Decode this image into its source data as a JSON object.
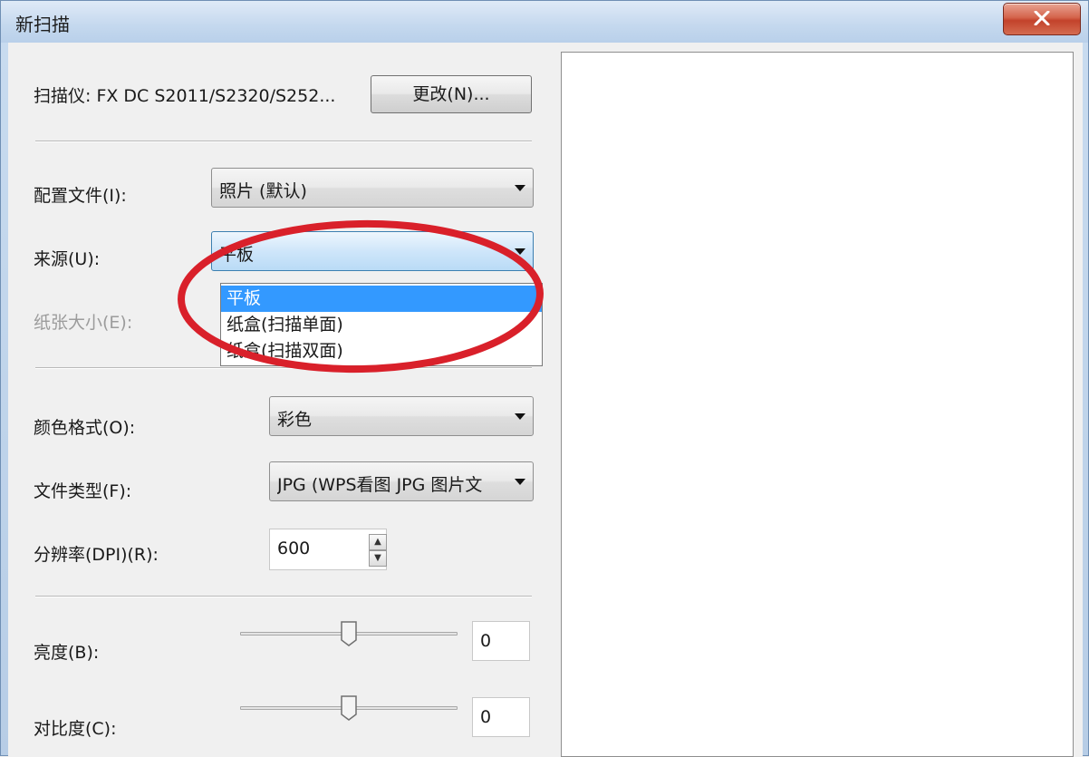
{
  "window": {
    "title": "新扫描",
    "close_icon": "close-icon"
  },
  "scanner": {
    "label": "扫描仪: FX DC S2011/S2320/S252...",
    "change_button": "更改(N)..."
  },
  "profile": {
    "label": "配置文件(I):",
    "value": "照片 (默认)"
  },
  "source": {
    "label": "来源(U):",
    "value": "平板",
    "options": [
      "平板",
      "纸盒(扫描单面)",
      "纸盒(扫描双面)"
    ],
    "selected_index": 0
  },
  "paper_size": {
    "label": "纸张大小(E):"
  },
  "color_format": {
    "label": "颜色格式(O):",
    "value": "彩色"
  },
  "file_type": {
    "label": "文件类型(F):",
    "value": "JPG (WPS看图 JPG 图片文"
  },
  "resolution": {
    "label": "分辨率(DPI)(R):",
    "value": "600"
  },
  "brightness": {
    "label": "亮度(B):",
    "value": "0",
    "level": 0.5
  },
  "contrast": {
    "label": "对比度(C):",
    "value": "0",
    "level": 0.5
  },
  "colors": {
    "highlight": "#3399ff",
    "annotation": "#d9202a"
  }
}
